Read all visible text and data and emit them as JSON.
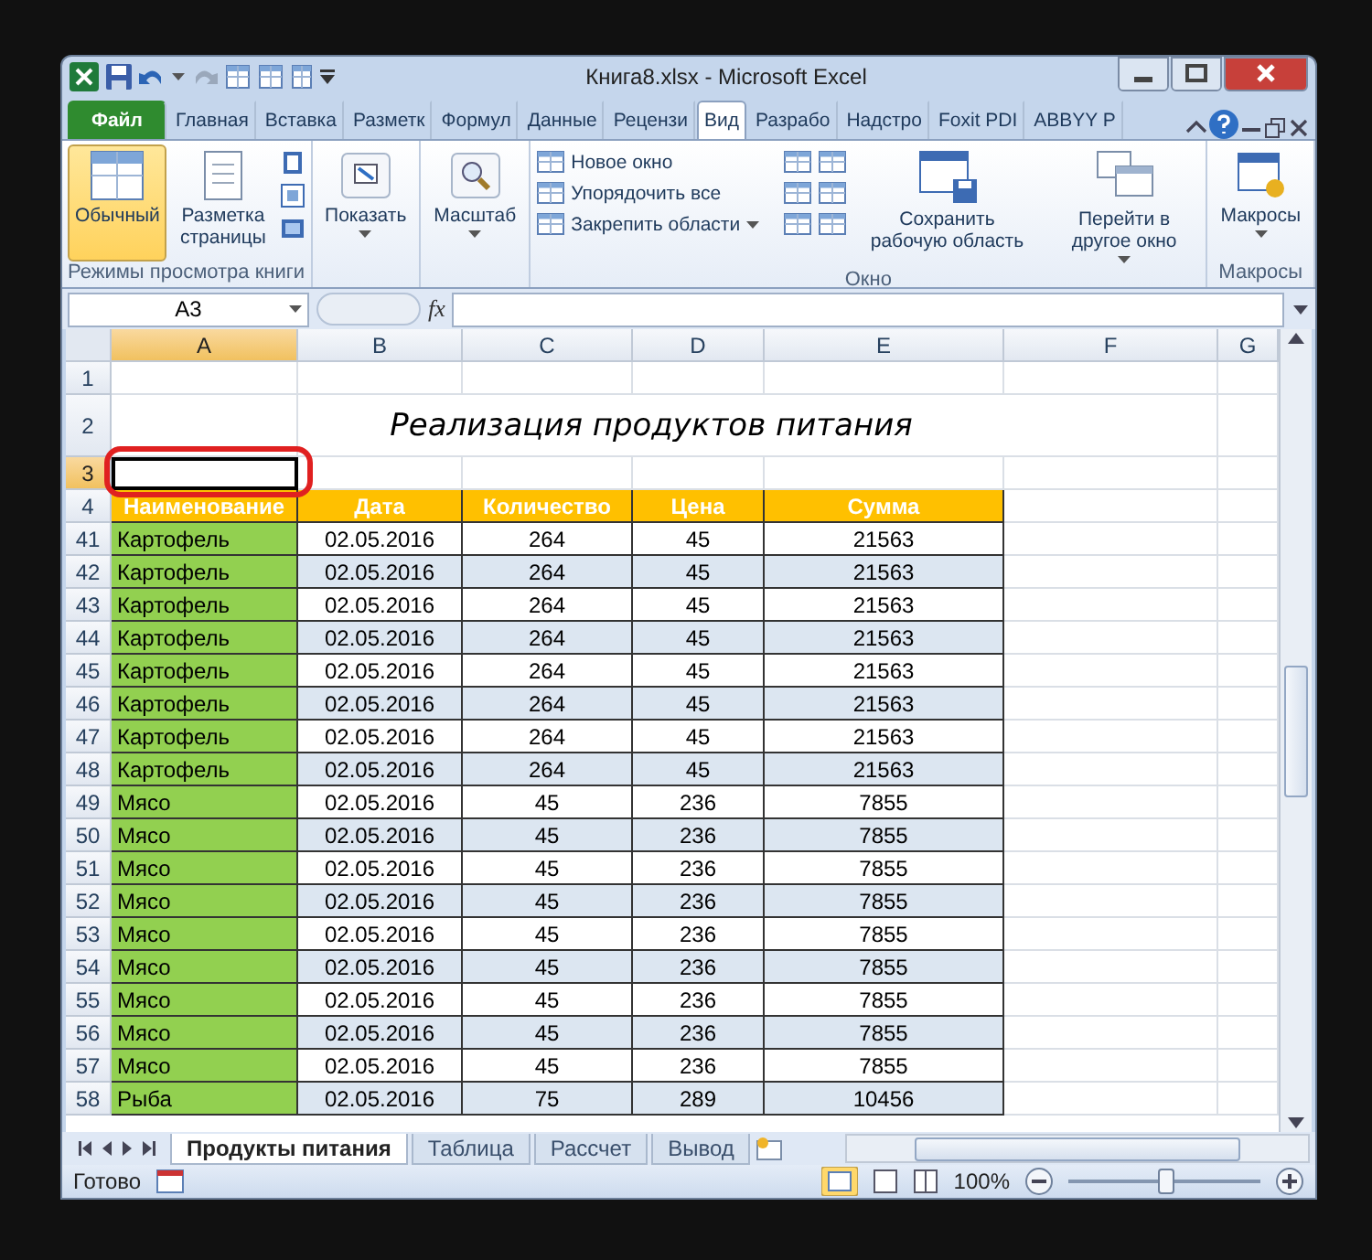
{
  "window": {
    "title": "Книга8.xlsx  -  Microsoft Excel"
  },
  "ribbon_tabs": [
    {
      "label": "Файл",
      "kind": "file",
      "selected": false
    },
    {
      "label": "Главная",
      "kind": "tab",
      "selected": false
    },
    {
      "label": "Вставка",
      "kind": "tab",
      "selected": false
    },
    {
      "label": "Разметк",
      "kind": "tab",
      "selected": false
    },
    {
      "label": "Формул",
      "kind": "tab",
      "selected": false
    },
    {
      "label": "Данные",
      "kind": "tab",
      "selected": false
    },
    {
      "label": "Рецензи",
      "kind": "tab",
      "selected": false
    },
    {
      "label": "Вид",
      "kind": "tab",
      "selected": true
    },
    {
      "label": "Разрабо",
      "kind": "tab",
      "selected": false
    },
    {
      "label": "Надстро",
      "kind": "tab",
      "selected": false
    },
    {
      "label": "Foxit PDI",
      "kind": "tab",
      "selected": false
    },
    {
      "label": "ABBYY P",
      "kind": "tab",
      "selected": false
    }
  ],
  "ribbon": {
    "views_group": {
      "label": "Режимы просмотра книги",
      "buttons": [
        {
          "label": "Обычный",
          "selected": true
        },
        {
          "label": "Разметка страницы",
          "selected": false
        }
      ]
    },
    "show_button": "Показать",
    "zoom_button": "Масштаб",
    "window_group": {
      "label": "Окно",
      "items": [
        "Новое окно",
        "Упорядочить все",
        "Закрепить области"
      ],
      "save_button": "Сохранить рабочую область",
      "switch_button": "Перейти в другое окно"
    },
    "macros_group": {
      "label": "Макросы",
      "button": "Макросы"
    }
  },
  "formula_bar": {
    "name_box": "A3",
    "function_label": "fx"
  },
  "sheet": {
    "title": "Реализация продуктов питания",
    "columns": [
      {
        "label": "A",
        "selected": true
      },
      {
        "label": "B",
        "selected": false
      },
      {
        "label": "C",
        "selected": false
      },
      {
        "label": "D",
        "selected": false
      },
      {
        "label": "E",
        "selected": false
      },
      {
        "label": "F",
        "selected": false
      },
      {
        "label": "G",
        "selected": false
      }
    ],
    "rows": [
      {
        "number": "1",
        "kind": "blank",
        "selected": false
      },
      {
        "number": "2",
        "kind": "title",
        "selected": false
      },
      {
        "number": "3",
        "kind": "blank",
        "selected": true
      },
      {
        "number": "4",
        "kind": "header",
        "selected": false,
        "cells": [
          "Наименование",
          "Дата",
          "Количество",
          "Цена",
          "Сумма"
        ]
      },
      {
        "number": "41",
        "kind": "data",
        "selected": false,
        "cells": [
          "Картофель",
          "02.05.2016",
          "264",
          "45",
          "21563"
        ]
      },
      {
        "number": "42",
        "kind": "data",
        "selected": false,
        "cells": [
          "Картофель",
          "02.05.2016",
          "264",
          "45",
          "21563"
        ]
      },
      {
        "number": "43",
        "kind": "data",
        "selected": false,
        "cells": [
          "Картофель",
          "02.05.2016",
          "264",
          "45",
          "21563"
        ]
      },
      {
        "number": "44",
        "kind": "data",
        "selected": false,
        "cells": [
          "Картофель",
          "02.05.2016",
          "264",
          "45",
          "21563"
        ]
      },
      {
        "number": "45",
        "kind": "data",
        "selected": false,
        "cells": [
          "Картофель",
          "02.05.2016",
          "264",
          "45",
          "21563"
        ]
      },
      {
        "number": "46",
        "kind": "data",
        "selected": false,
        "cells": [
          "Картофель",
          "02.05.2016",
          "264",
          "45",
          "21563"
        ]
      },
      {
        "number": "47",
        "kind": "data",
        "selected": false,
        "cells": [
          "Картофель",
          "02.05.2016",
          "264",
          "45",
          "21563"
        ]
      },
      {
        "number": "48",
        "kind": "data",
        "selected": false,
        "cells": [
          "Картофель",
          "02.05.2016",
          "264",
          "45",
          "21563"
        ]
      },
      {
        "number": "49",
        "kind": "data",
        "selected": false,
        "cells": [
          "Мясо",
          "02.05.2016",
          "45",
          "236",
          "7855"
        ]
      },
      {
        "number": "50",
        "kind": "data",
        "selected": false,
        "cells": [
          "Мясо",
          "02.05.2016",
          "45",
          "236",
          "7855"
        ]
      },
      {
        "number": "51",
        "kind": "data",
        "selected": false,
        "cells": [
          "Мясо",
          "02.05.2016",
          "45",
          "236",
          "7855"
        ]
      },
      {
        "number": "52",
        "kind": "data",
        "selected": false,
        "cells": [
          "Мясо",
          "02.05.2016",
          "45",
          "236",
          "7855"
        ]
      },
      {
        "number": "53",
        "kind": "data",
        "selected": false,
        "cells": [
          "Мясо",
          "02.05.2016",
          "45",
          "236",
          "7855"
        ]
      },
      {
        "number": "54",
        "kind": "data",
        "selected": false,
        "cells": [
          "Мясо",
          "02.05.2016",
          "45",
          "236",
          "7855"
        ]
      },
      {
        "number": "55",
        "kind": "data",
        "selected": false,
        "cells": [
          "Мясо",
          "02.05.2016",
          "45",
          "236",
          "7855"
        ]
      },
      {
        "number": "56",
        "kind": "data",
        "selected": false,
        "cells": [
          "Мясо",
          "02.05.2016",
          "45",
          "236",
          "7855"
        ]
      },
      {
        "number": "57",
        "kind": "data",
        "selected": false,
        "cells": [
          "Мясо",
          "02.05.2016",
          "45",
          "236",
          "7855"
        ]
      },
      {
        "number": "58",
        "kind": "data",
        "selected": false,
        "cells": [
          "Рыба",
          "02.05.2016",
          "75",
          "289",
          "10456"
        ]
      }
    ]
  },
  "sheet_tabs": [
    {
      "label": "Продукты питания",
      "selected": true
    },
    {
      "label": "Таблица",
      "selected": false
    },
    {
      "label": "Рассчет",
      "selected": false
    },
    {
      "label": "Вывод",
      "selected": false
    }
  ],
  "status_bar": {
    "status": "Готово",
    "zoom": "100%",
    "level": 0.5
  }
}
